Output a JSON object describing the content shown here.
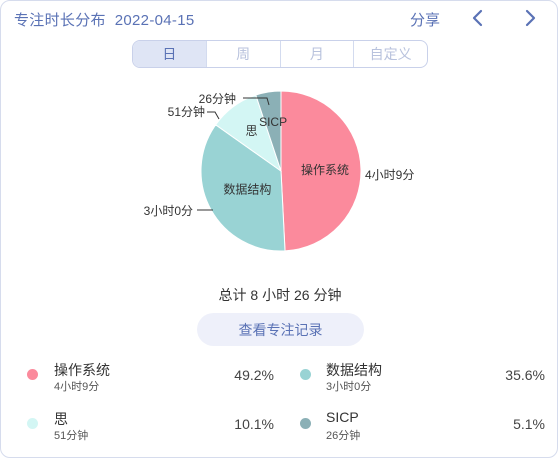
{
  "header": {
    "title": "专注时长分布",
    "date": "2022-04-15",
    "share_label": "分享",
    "prev_icon": "chevron-left-icon",
    "next_icon": "chevron-right-icon",
    "accent_color": "#5a72b5"
  },
  "segments": [
    {
      "label": "日",
      "active": true
    },
    {
      "label": "周",
      "active": false
    },
    {
      "label": "月",
      "active": false
    },
    {
      "label": "自定义",
      "active": false
    }
  ],
  "chart_data": {
    "type": "pie",
    "slices": [
      {
        "name": "操作系统",
        "value": 49.2,
        "duration_label": "4小时9分",
        "color": "#fb8a9c"
      },
      {
        "name": "数据结构",
        "value": 35.6,
        "duration_label": "3小时0分",
        "color": "#99d3d4"
      },
      {
        "name": "思",
        "value": 10.1,
        "duration_label": "51分钟",
        "color": "#d3f6f4"
      },
      {
        "name": "SICP",
        "value": 5.1,
        "duration_label": "26分钟",
        "color": "#8bb0b6"
      }
    ]
  },
  "summary": {
    "total_label": "总计 8 小时 26 分钟",
    "view_button_label": "查看专注记录"
  },
  "legend": [
    {
      "name": "操作系统",
      "sub": "4小时9分",
      "pct": "49.2%",
      "color": "#fb8a9c"
    },
    {
      "name": "数据结构",
      "sub": "3小时0分",
      "pct": "35.6%",
      "color": "#99d3d4"
    },
    {
      "name": "思",
      "sub": "51分钟",
      "pct": "10.1%",
      "color": "#d3f6f4"
    },
    {
      "name": "SICP",
      "sub": "26分钟",
      "pct": "5.1%",
      "color": "#8bb0b6"
    }
  ]
}
